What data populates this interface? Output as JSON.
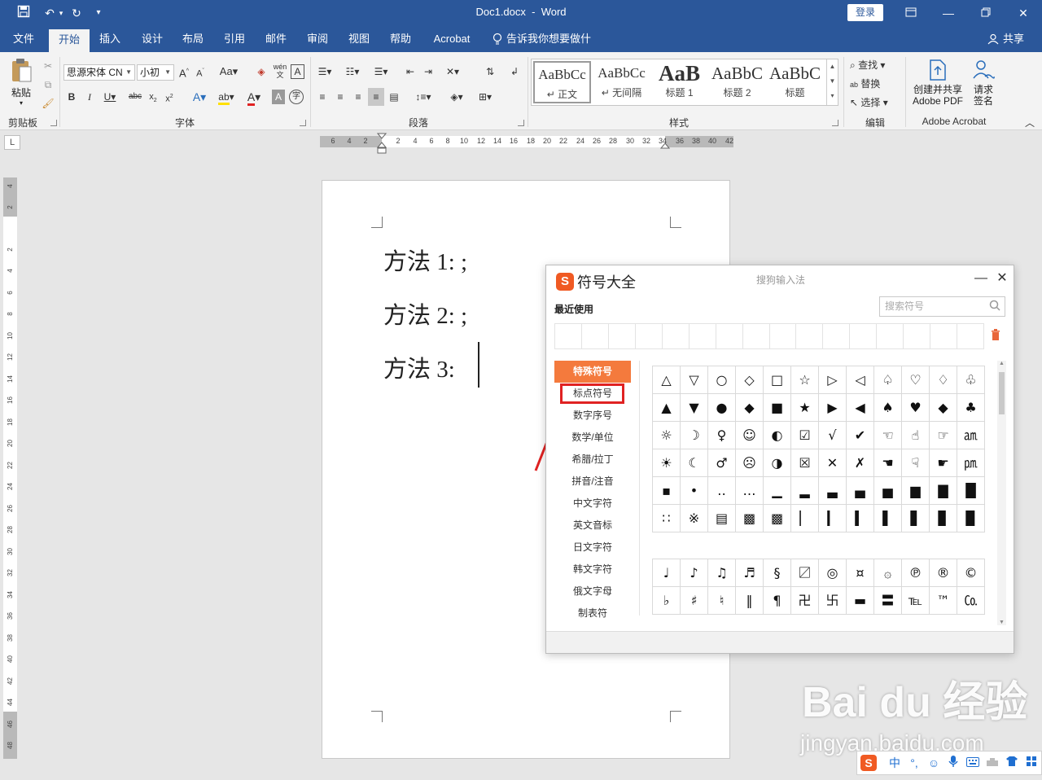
{
  "title": {
    "doc": "Doc1.docx",
    "sep": "-",
    "app": "Word"
  },
  "titlebar": {
    "login": "登录",
    "save_icon": "save-icon",
    "undo_icon": "undo-icon",
    "redo_icon": "redo-icon",
    "customize": "▾"
  },
  "tabs": [
    "文件",
    "开始",
    "插入",
    "设计",
    "布局",
    "引用",
    "邮件",
    "审阅",
    "视图",
    "帮助",
    "Acrobat",
    "告诉我你想要做什么"
  ],
  "share": "共享",
  "ribbon": {
    "paste": "粘贴",
    "clipboard": "剪贴板",
    "font_name": "思源宋体 CN",
    "font_size": "小初",
    "font_group": "字体",
    "paragraph_group": "段落",
    "styles_group": "样式",
    "edit_group": "编辑",
    "acrobat_group": "Adobe Acrobat",
    "find": "查找",
    "replace": "替换",
    "select": "选择",
    "create_pdf": "创建并共享 Adobe PDF",
    "request_sign": "请求签名",
    "wen": "wén",
    "styles": [
      {
        "preview": "AaBbCc",
        "name": "↵ 正文"
      },
      {
        "preview": "AaBbCc",
        "name": "↵ 无间隔"
      },
      {
        "preview": "AaB",
        "name": "标题 1"
      },
      {
        "preview": "AaBbC",
        "name": "标题 2"
      },
      {
        "preview": "AaBbC",
        "name": "标题"
      }
    ]
  },
  "ruler": {
    "h_ticks": [
      "6",
      "4",
      "2",
      "2",
      "4",
      "6",
      "8",
      "10",
      "12",
      "14",
      "16",
      "18",
      "20",
      "22",
      "24",
      "26",
      "28",
      "30",
      "32",
      "34",
      "36",
      "38",
      "40",
      "42"
    ],
    "v_ticks": [
      "4",
      "2",
      "2",
      "4",
      "6",
      "8",
      "10",
      "12",
      "14",
      "16",
      "18",
      "20",
      "22",
      "24",
      "26",
      "28",
      "30",
      "32",
      "34",
      "36",
      "38",
      "40",
      "42",
      "44",
      "46",
      "48"
    ]
  },
  "document": {
    "lines": [
      "方法 1: ;",
      "方法 2: ;",
      "方法 3:"
    ]
  },
  "dialog": {
    "logo": "S",
    "title": "符号大全",
    "subtitle": "搜狗输入法",
    "recent": "最近使用",
    "search_placeholder": "搜索符号",
    "categories": [
      "特殊符号",
      "标点符号",
      "数字序号",
      "数学/单位",
      "希腊/拉丁",
      "拼音/注音",
      "中文字符",
      "英文音标",
      "日文字符",
      "韩文字符",
      "俄文字母",
      "制表符"
    ],
    "grid1": [
      "△",
      "▽",
      "○",
      "◇",
      "□",
      "☆",
      "▷",
      "◁",
      "♤",
      "♡",
      "♢",
      "♧",
      "▲",
      "▼",
      "●",
      "◆",
      "■",
      "★",
      "▶",
      "◀",
      "♠",
      "♥",
      "◆",
      "♣",
      "☼",
      "☽",
      "♀",
      "☺",
      "◐",
      "☑",
      "√",
      "✔",
      "☜",
      "☝",
      "☞",
      "㏂",
      "☀",
      "☾",
      "♂",
      "☹",
      "◑",
      "☒",
      "✕",
      "✗",
      "☚",
      "☟",
      "☛",
      "㏘",
      "▪",
      "•",
      "‥",
      "…",
      "▁",
      "▂",
      "▃",
      "▄",
      "▅",
      "▆",
      "▇",
      "█",
      "∷",
      "※",
      "▤",
      "▩",
      "▩",
      "▏",
      "▎",
      "▍",
      "▌",
      "▋",
      "▊",
      "▉"
    ],
    "grid2": [
      "♩",
      "♪",
      "♫",
      "♬",
      "§",
      "〼",
      "◎",
      "¤",
      "۞",
      "℗",
      "®",
      "©",
      "♭",
      "♯",
      "♮",
      "‖",
      "¶",
      "卍",
      "卐",
      "▬",
      "〓",
      "℡",
      "™",
      "㏇"
    ]
  },
  "watermark": {
    "brand": "Bai du 经验",
    "url": "jingyan.baidu.com"
  },
  "ime": {
    "logo": "S",
    "lang": "中",
    "punct": "°,",
    "emoji": "☺",
    "mic": "mic-icon",
    "keyboard": "keyboard-icon",
    "skin": "skin-icon",
    "tools": "tools-icon",
    "more": "grid-icon"
  }
}
